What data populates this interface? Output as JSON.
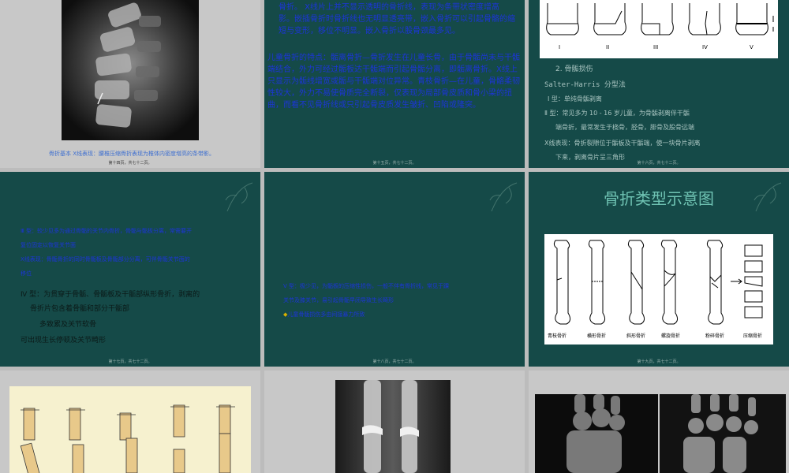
{
  "slides": [
    {
      "id": 1,
      "caption": "骨折基本 X线表现：腰椎压缩骨折表现为椎体内密度增高的条带影。",
      "footer": "第十四页，共七十二页。"
    },
    {
      "id": 2,
      "para1": "骨折。 X线片上并不显示透明的骨折线，表现为条带状密度增高影。嵌插骨折时骨折线也无明显透亮带，嵌入骨折可以引起骨骼的缩短与变形，移位不明显。嵌入骨折以股骨颈最多见。",
      "para2": "儿童骨折的特点：骺离骨折—骨折发生在儿童长骨，由于骨骺尚未与干骺端结合，外力可经过骺板达干骺端而引起骨骺分离，即骺离骨折。X线上只显示为骺线增宽或骺与干骺端对位异常。青枝骨折—在儿童，骨骼柔韧性较大，外力不易使骨质完全断裂，仅表现为局部骨皮质和骨小梁的扭曲，而看不见骨折线或只引起骨皮质发生皱折、凹陷或隆突。",
      "footer": "第十五页，共七十二页。"
    },
    {
      "id": 3,
      "roman": [
        "I",
        "II",
        "III",
        "IV",
        "V"
      ],
      "heading": "2. 骨骺损伤",
      "subheading": "Salter-Harris 分型法",
      "type1": "Ⅰ 型：单纯骨骺剥离",
      "type2a": "Ⅱ 型：常见多为 10 - 16 岁儿童，为骨骺剥离伴干骺",
      "type2b": "端骨折，最常发生于桡骨，胫骨，腓骨及股骨远端",
      "xray1": "X线表现：骨折裂隙位于骺板及干骺端，使一块骨片剥离",
      "xray2": "下来，剥离骨片呈三角形",
      "footer": "第十六页，共七十二页。"
    },
    {
      "id": 4,
      "line1": "Ⅲ 型：较少见多为通过骨骺的关节内骨折，骨骺与骺板分离，常需要开",
      "line2": "复位固定以恢复关节面",
      "line3": "X线表现：骨骺骨折的同时骨骺板及骨骺部分分离，可伴骨骺关节面的",
      "line4": "移位",
      "line5": "Ⅳ 型：为贯穿于骨骺、骨骺板及干骺部纵形骨折，剥离的",
      "line6": "骨折片包含着骨骺和部分干骺部",
      "line7": "多致累及关节软骨",
      "line8": "可出现生长停顿及关节畸形",
      "footer": "第十七页，共七十二页。"
    },
    {
      "id": 5,
      "line1": "Ⅴ 型：极少见，为骺板的压缩性损伤，一般不伴有骨折线，常见于踝",
      "line2": "关节及膝关节，易引起骨骺早闭导致生长畸形",
      "bullet": "◆",
      "line3": "儿童骨骺损伤多由间接暴力所致",
      "footer": "第十八页，共七十二页。"
    },
    {
      "id": 6,
      "title": "骨折类型示意图",
      "labels": [
        "青枝骨折",
        "横形骨折",
        "斜形骨折",
        "螺旋骨折",
        "粉碎骨折",
        "压缩骨折"
      ],
      "footer": "第十九页，共七十二页。"
    },
    {
      "id": 7,
      "footer": ""
    },
    {
      "id": 8,
      "footer": ""
    },
    {
      "id": 9,
      "footer": ""
    }
  ]
}
